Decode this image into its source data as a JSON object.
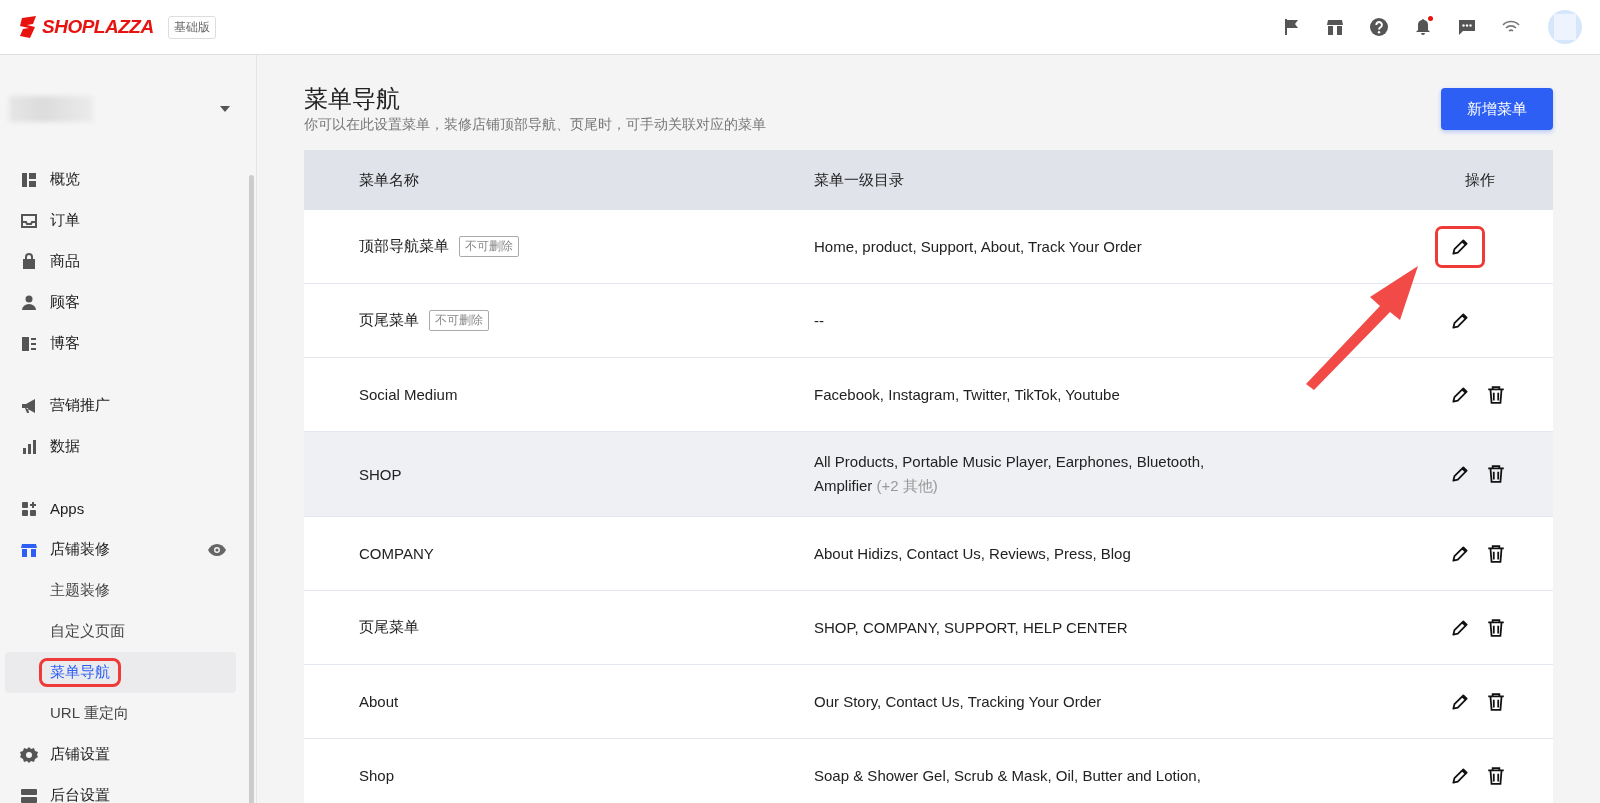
{
  "topbar": {
    "logo": "SHOPLAZZA",
    "plan": "基础版",
    "notification_dot": true
  },
  "sidebar": {
    "groups": [
      {
        "items": [
          {
            "label": "概览",
            "selected": false,
            "highlighted": false
          },
          {
            "label": "订单",
            "selected": false,
            "highlighted": false
          },
          {
            "label": "商品",
            "selected": false,
            "highlighted": false
          },
          {
            "label": "顾客",
            "selected": false,
            "highlighted": false
          },
          {
            "label": "博客",
            "selected": false,
            "highlighted": false
          }
        ]
      },
      {
        "items": [
          {
            "label": "营销推广",
            "selected": false,
            "highlighted": false
          },
          {
            "label": "数据",
            "selected": false,
            "highlighted": false
          }
        ]
      },
      {
        "items": [
          {
            "label": "Apps",
            "selected": false,
            "highlighted": false
          },
          {
            "label": "店铺装修",
            "selected": false,
            "highlighted": false,
            "expanded": true,
            "children": [
              {
                "label": "主题装修",
                "selected": false,
                "highlighted": false
              },
              {
                "label": "自定义页面",
                "selected": false,
                "highlighted": false
              },
              {
                "label": "菜单导航",
                "selected": true,
                "highlighted": true
              },
              {
                "label": "URL 重定向",
                "selected": false,
                "highlighted": false
              }
            ]
          },
          {
            "label": "店铺设置",
            "selected": false,
            "highlighted": false
          },
          {
            "label": "后台设置",
            "selected": false,
            "highlighted": false
          }
        ]
      }
    ]
  },
  "page": {
    "title": "菜单导航",
    "subtitle": "你可以在此设置菜单，装修店铺顶部导航、页尾时，可手动关联对应的菜单",
    "add_button": "新增菜单"
  },
  "table": {
    "columns": [
      "菜单名称",
      "菜单一级目录",
      "操作"
    ],
    "rows": [
      {
        "name": "顶部导航菜单",
        "tag": "不可删除",
        "items": "Home, product, Support, About, Track Your Order",
        "deletable": false,
        "edit_highlighted": true,
        "hover": false
      },
      {
        "name": "页尾菜单",
        "tag": "不可删除",
        "items": "--",
        "deletable": false,
        "edit_highlighted": false,
        "hover": false
      },
      {
        "name": "Social Medium",
        "items": "Facebook, Instagram, Twitter, TikTok, Youtube",
        "deletable": true,
        "edit_highlighted": false,
        "hover": false
      },
      {
        "name": "SHOP",
        "items": "All Products, Portable Music Player, Earphones, Bluetooth, Amplifier",
        "more": "(+2 其他)",
        "deletable": true,
        "edit_highlighted": false,
        "hover": true
      },
      {
        "name": "COMPANY",
        "items": "About Hidizs, Contact Us, Reviews, Press, Blog",
        "deletable": true,
        "edit_highlighted": false,
        "hover": false
      },
      {
        "name": "页尾菜单",
        "items": "SHOP, COMPANY, SUPPORT, HELP CENTER",
        "deletable": true,
        "edit_highlighted": false,
        "hover": false
      },
      {
        "name": "About",
        "items": "Our Story, Contact Us, Tracking Your Order",
        "deletable": true,
        "edit_highlighted": false,
        "hover": false
      },
      {
        "name": "Shop",
        "items": "Soap & Shower Gel, Scrub & Mask, Oil, Butter and Lotion,",
        "deletable": true,
        "edit_highlighted": false,
        "hover": false
      }
    ]
  }
}
